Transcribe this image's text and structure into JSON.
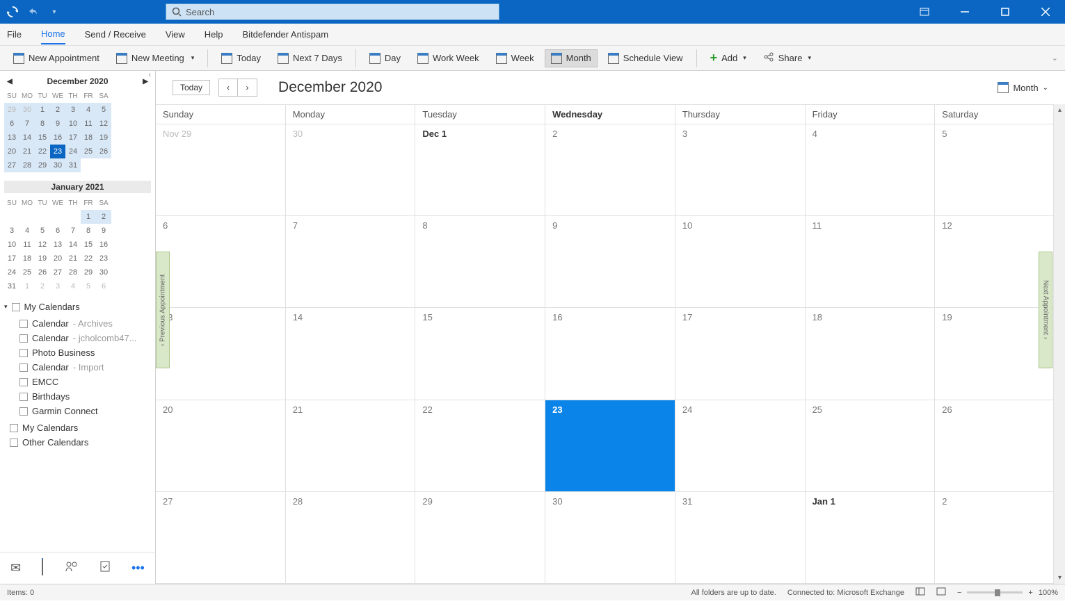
{
  "titlebar": {
    "search_placeholder": "Search"
  },
  "menu": {
    "items": [
      "File",
      "Home",
      "Send / Receive",
      "View",
      "Help",
      "Bitdefender Antispam"
    ],
    "active": "Home"
  },
  "ribbon": {
    "new_appointment": "New Appointment",
    "new_meeting": "New Meeting",
    "today": "Today",
    "next7": "Next 7 Days",
    "day": "Day",
    "work_week": "Work Week",
    "week": "Week",
    "month": "Month",
    "schedule": "Schedule View",
    "add": "Add",
    "share": "Share"
  },
  "sidebar": {
    "minical1": {
      "title": "December 2020",
      "dow": [
        "SU",
        "MO",
        "TU",
        "WE",
        "TH",
        "FR",
        "SA"
      ],
      "rows": [
        [
          {
            "n": "29",
            "cls": "inmonth gray"
          },
          {
            "n": "30",
            "cls": "inmonth gray"
          },
          {
            "n": "1",
            "cls": "inmonth"
          },
          {
            "n": "2",
            "cls": "inmonth"
          },
          {
            "n": "3",
            "cls": "inmonth"
          },
          {
            "n": "4",
            "cls": "inmonth"
          },
          {
            "n": "5",
            "cls": "inmonth"
          }
        ],
        [
          {
            "n": "6",
            "cls": "inmonth"
          },
          {
            "n": "7",
            "cls": "inmonth"
          },
          {
            "n": "8",
            "cls": "inmonth"
          },
          {
            "n": "9",
            "cls": "inmonth"
          },
          {
            "n": "10",
            "cls": "inmonth"
          },
          {
            "n": "11",
            "cls": "inmonth"
          },
          {
            "n": "12",
            "cls": "inmonth"
          }
        ],
        [
          {
            "n": "13",
            "cls": "inmonth"
          },
          {
            "n": "14",
            "cls": "inmonth"
          },
          {
            "n": "15",
            "cls": "inmonth"
          },
          {
            "n": "16",
            "cls": "inmonth"
          },
          {
            "n": "17",
            "cls": "inmonth"
          },
          {
            "n": "18",
            "cls": "inmonth"
          },
          {
            "n": "19",
            "cls": "inmonth"
          }
        ],
        [
          {
            "n": "20",
            "cls": "inmonth"
          },
          {
            "n": "21",
            "cls": "inmonth"
          },
          {
            "n": "22",
            "cls": "inmonth"
          },
          {
            "n": "23",
            "cls": "today"
          },
          {
            "n": "24",
            "cls": "inmonth"
          },
          {
            "n": "25",
            "cls": "inmonth"
          },
          {
            "n": "26",
            "cls": "inmonth"
          }
        ],
        [
          {
            "n": "27",
            "cls": "inmonth"
          },
          {
            "n": "28",
            "cls": "inmonth"
          },
          {
            "n": "29",
            "cls": "inmonth"
          },
          {
            "n": "30",
            "cls": "inmonth"
          },
          {
            "n": "31",
            "cls": "inmonth"
          },
          {
            "n": "",
            "cls": ""
          },
          {
            "n": "",
            "cls": ""
          }
        ]
      ]
    },
    "minical2": {
      "title": "January 2021",
      "dow": [
        "SU",
        "MO",
        "TU",
        "WE",
        "TH",
        "FR",
        "SA"
      ],
      "rows": [
        [
          {
            "n": ""
          },
          {
            "n": ""
          },
          {
            "n": ""
          },
          {
            "n": ""
          },
          {
            "n": ""
          },
          {
            "n": "1",
            "cls": "inmonth"
          },
          {
            "n": "2",
            "cls": "inmonth"
          }
        ],
        [
          {
            "n": "3"
          },
          {
            "n": "4"
          },
          {
            "n": "5"
          },
          {
            "n": "6"
          },
          {
            "n": "7"
          },
          {
            "n": "8"
          },
          {
            "n": "9"
          }
        ],
        [
          {
            "n": "10"
          },
          {
            "n": "11"
          },
          {
            "n": "12"
          },
          {
            "n": "13"
          },
          {
            "n": "14"
          },
          {
            "n": "15"
          },
          {
            "n": "16"
          }
        ],
        [
          {
            "n": "17"
          },
          {
            "n": "18"
          },
          {
            "n": "19"
          },
          {
            "n": "20"
          },
          {
            "n": "21"
          },
          {
            "n": "22"
          },
          {
            "n": "23"
          }
        ],
        [
          {
            "n": "24"
          },
          {
            "n": "25"
          },
          {
            "n": "26"
          },
          {
            "n": "27"
          },
          {
            "n": "28"
          },
          {
            "n": "29"
          },
          {
            "n": "30"
          }
        ],
        [
          {
            "n": "31"
          },
          {
            "n": "1",
            "cls": "gray"
          },
          {
            "n": "2",
            "cls": "gray"
          },
          {
            "n": "3",
            "cls": "gray"
          },
          {
            "n": "4",
            "cls": "gray"
          },
          {
            "n": "5",
            "cls": "gray"
          },
          {
            "n": "6",
            "cls": "gray"
          }
        ]
      ]
    },
    "group1_title": "My Calendars",
    "group1": [
      {
        "label": "Calendar",
        "sub": " - Archives"
      },
      {
        "label": "Calendar",
        "sub": " - jcholcomb47..."
      },
      {
        "label": "Photo Business",
        "sub": ""
      },
      {
        "label": "Calendar",
        "sub": " - Import"
      },
      {
        "label": "EMCC",
        "sub": ""
      },
      {
        "label": "Birthdays",
        "sub": ""
      },
      {
        "label": "Garmin Connect",
        "sub": ""
      }
    ],
    "my_calendars2": "My Calendars",
    "other_calendars": "Other Calendars"
  },
  "calendar": {
    "today_btn": "Today",
    "title": "December 2020",
    "view_label": "Month",
    "prev_appt": "Previous Appointment",
    "next_appt": "Next Appointment",
    "day_headers": [
      "Sunday",
      "Monday",
      "Tuesday",
      "Wednesday",
      "Thursday",
      "Friday",
      "Saturday"
    ],
    "day_header_bold_idx": 3,
    "weeks": [
      [
        {
          "t": "Nov 29",
          "cls": "gray"
        },
        {
          "t": "30",
          "cls": "gray"
        },
        {
          "t": "Dec 1",
          "cls": "bold"
        },
        {
          "t": "2"
        },
        {
          "t": "3"
        },
        {
          "t": "4"
        },
        {
          "t": "5"
        }
      ],
      [
        {
          "t": "6"
        },
        {
          "t": "7"
        },
        {
          "t": "8"
        },
        {
          "t": "9"
        },
        {
          "t": "10"
        },
        {
          "t": "11"
        },
        {
          "t": "12"
        }
      ],
      [
        {
          "t": "13"
        },
        {
          "t": "14"
        },
        {
          "t": "15"
        },
        {
          "t": "16"
        },
        {
          "t": "17"
        },
        {
          "t": "18"
        },
        {
          "t": "19"
        }
      ],
      [
        {
          "t": "20"
        },
        {
          "t": "21"
        },
        {
          "t": "22"
        },
        {
          "t": "23",
          "cls": "today"
        },
        {
          "t": "24"
        },
        {
          "t": "25"
        },
        {
          "t": "26"
        }
      ],
      [
        {
          "t": "27"
        },
        {
          "t": "28"
        },
        {
          "t": "29"
        },
        {
          "t": "30"
        },
        {
          "t": "31"
        },
        {
          "t": "Jan 1",
          "cls": "bold"
        },
        {
          "t": "2"
        }
      ]
    ]
  },
  "status": {
    "items": "Items: 0",
    "folders": "All folders are up to date.",
    "connected": "Connected to: Microsoft Exchange",
    "zoom": "100%"
  }
}
